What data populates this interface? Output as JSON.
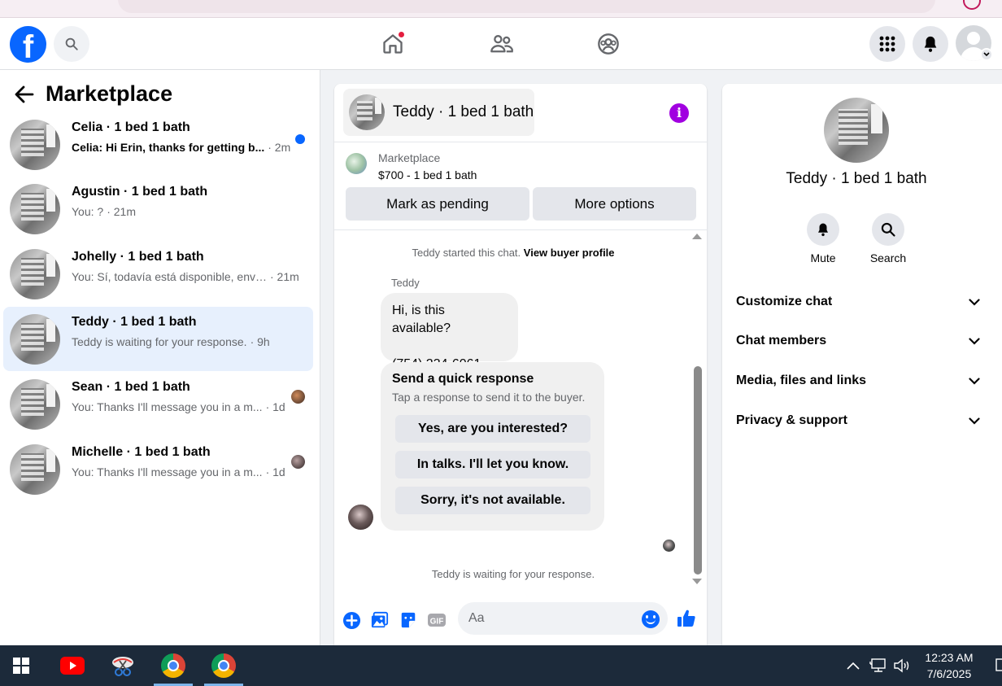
{
  "nav": {
    "logo_letter": "f"
  },
  "left_panel": {
    "title": "Marketplace",
    "conversations": [
      {
        "name": "Celia · 1 bed 1 bath",
        "preview": "Celia: Hi Erin, thanks for getting b...",
        "time": "· 2m",
        "unread": true
      },
      {
        "name": "Agustin · 1 bed 1 bath",
        "preview": "You: ?",
        "time": "· 21m",
        "unread": false
      },
      {
        "name": "Johelly · 1 bed 1 bath",
        "preview": "You: Sí, todavía está disponible, enví...",
        "time": "· 21m",
        "unread": false
      },
      {
        "name": "Teddy · 1 bed 1 bath",
        "preview": "Teddy is waiting for your response.",
        "time": "· 9h",
        "unread": false
      },
      {
        "name": "Sean · 1 bed 1 bath",
        "preview": "You: Thanks I'll message you in a m...",
        "time": "· 1d",
        "unread": false
      },
      {
        "name": "Michelle · 1 bed 1 bath",
        "preview": "You: Thanks I'll message you in a m...",
        "time": "· 1d",
        "unread": false
      }
    ]
  },
  "chat": {
    "title": "Teddy · 1 bed 1 bath",
    "listing_label": "Marketplace",
    "listing_price": "$700 - 1 bed 1 bath",
    "mark_pending": "Mark as pending",
    "more_options": "More options",
    "started_text": "Teddy started this chat.",
    "view_profile": "View buyer profile",
    "sender": "Teddy",
    "message_line1": "Hi, is this available?",
    "message_line2": "(754) 234-6061",
    "quick_title": "Send a quick response",
    "quick_subtitle": "Tap a response to send it to the buyer.",
    "quick_responses": [
      "Yes, are you interested?",
      "In talks. I'll let you know.",
      "Sorry, it's not available."
    ],
    "waiting_text": "Teddy is waiting for your response.",
    "input_placeholder": "Aa"
  },
  "right_panel": {
    "title": "Teddy · 1 bed 1 bath",
    "mute": "Mute",
    "search": "Search",
    "sections": [
      "Customize chat",
      "Chat members",
      "Media, files and links",
      "Privacy & support"
    ]
  },
  "taskbar": {
    "time": "12:23 AM",
    "date": "7/6/2025"
  },
  "colors": {
    "brand": "#0866ff",
    "info": "#a100e0",
    "taskbar": "#1c2a3a"
  }
}
